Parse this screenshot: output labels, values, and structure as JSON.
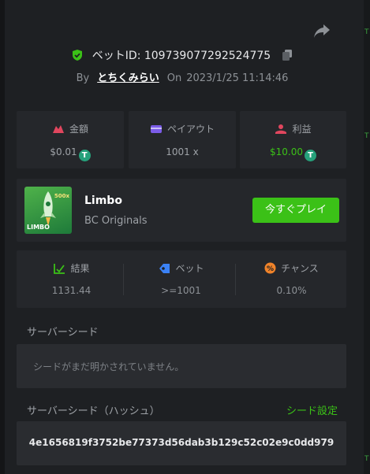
{
  "header": {
    "bet_id_label": "ベットID: 109739077292524775",
    "by_label": "By",
    "username": "とちくみらい",
    "on_label": "On",
    "timestamp": "2023/1/25 11:14:46"
  },
  "stats": {
    "amount": {
      "label": "金額",
      "value": "$0.01"
    },
    "payout": {
      "label": "ペイアウト",
      "value": "1001 x"
    },
    "profit": {
      "label": "利益",
      "value": "$10.00"
    },
    "coin_symbol": "T"
  },
  "game": {
    "name": "Limbo",
    "provider": "BC Originals",
    "play_label": "今すぐプレイ",
    "thumb_brand": "LIMBO",
    "thumb_badge": "500x"
  },
  "result": {
    "result": {
      "label": "結果",
      "value": "1131.44"
    },
    "bet": {
      "label": "ベット",
      "value": ">=1001"
    },
    "chance": {
      "label": "チャンス",
      "value": "0.10%"
    }
  },
  "server_seed": {
    "label": "サーバーシード",
    "placeholder": "シードがまだ明かされていません。"
  },
  "server_seed_hash": {
    "label": "サーバーシード（ハッシュ）",
    "link_label": "シード設定",
    "value": "4e1656819f3752be77373d56dab3b129c52c02e9c0dd979"
  },
  "colors": {
    "background": "#1e2023",
    "panel": "#25272b",
    "accent_green": "#3bc117",
    "amount_icon": "#e0465e",
    "payout_icon": "#7b5ce8",
    "profit_icon": "#e0465e",
    "bet_icon": "#3b82f6",
    "chance_icon": "#f0832a"
  },
  "icons": [
    "share-icon",
    "shield-check-icon",
    "copy-icon",
    "amount-icon",
    "payout-icon",
    "profit-icon",
    "result-icon",
    "bet-icon",
    "chance-icon",
    "tether-coin-icon"
  ]
}
